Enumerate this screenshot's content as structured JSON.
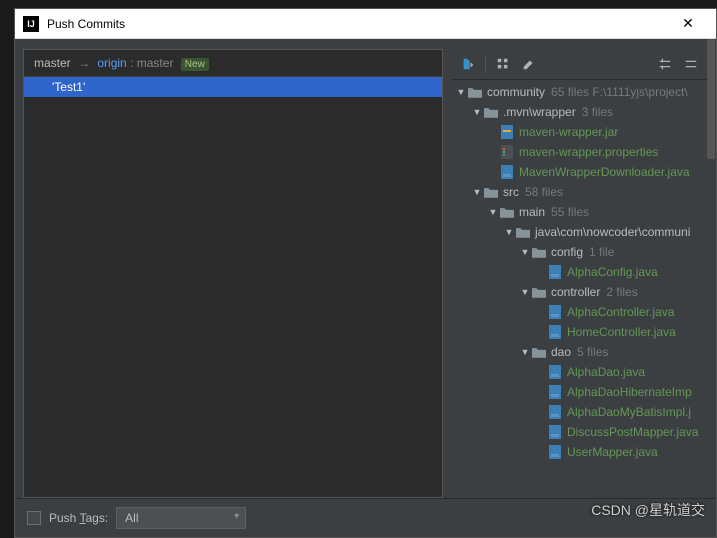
{
  "window": {
    "title": "Push Commits"
  },
  "branch": {
    "local": "master",
    "arrow": "→",
    "remote": "origin",
    "sep": ":",
    "tracking": "master",
    "new_badge": "New"
  },
  "commits": [
    {
      "label": "'Test1'"
    }
  ],
  "tree": [
    {
      "depth": 0,
      "expand": "▼",
      "kind": "folder",
      "name": "community",
      "meta": "65 files  F:\\1111yjs\\project\\"
    },
    {
      "depth": 1,
      "expand": "▼",
      "kind": "folder",
      "name": ".mvn\\wrapper",
      "meta": "3 files"
    },
    {
      "depth": 2,
      "expand": "",
      "kind": "jar",
      "name": "maven-wrapper.jar",
      "added": true
    },
    {
      "depth": 2,
      "expand": "",
      "kind": "props",
      "name": "maven-wrapper.properties",
      "added": true
    },
    {
      "depth": 2,
      "expand": "",
      "kind": "java",
      "name": "MavenWrapperDownloader.java",
      "added": true
    },
    {
      "depth": 1,
      "expand": "▼",
      "kind": "folder",
      "name": "src",
      "meta": "58 files"
    },
    {
      "depth": 2,
      "expand": "▼",
      "kind": "folder",
      "name": "main",
      "meta": "55 files"
    },
    {
      "depth": 3,
      "expand": "▼",
      "kind": "folder",
      "name": "java\\com\\nowcoder\\communi"
    },
    {
      "depth": 4,
      "expand": "▼",
      "kind": "folder",
      "name": "config",
      "meta": "1 file"
    },
    {
      "depth": 5,
      "expand": "",
      "kind": "java",
      "name": "AlphaConfig.java",
      "added": true
    },
    {
      "depth": 4,
      "expand": "▼",
      "kind": "folder",
      "name": "controller",
      "meta": "2 files"
    },
    {
      "depth": 5,
      "expand": "",
      "kind": "java",
      "name": "AlphaController.java",
      "added": true
    },
    {
      "depth": 5,
      "expand": "",
      "kind": "java",
      "name": "HomeController.java",
      "added": true
    },
    {
      "depth": 4,
      "expand": "▼",
      "kind": "folder",
      "name": "dao",
      "meta": "5 files"
    },
    {
      "depth": 5,
      "expand": "",
      "kind": "java",
      "name": "AlphaDao.java",
      "added": true
    },
    {
      "depth": 5,
      "expand": "",
      "kind": "java",
      "name": "AlphaDaoHibernateImp",
      "added": true
    },
    {
      "depth": 5,
      "expand": "",
      "kind": "java",
      "name": "AlphaDaoMyBatisImpl.j",
      "added": true
    },
    {
      "depth": 5,
      "expand": "",
      "kind": "java",
      "name": "DiscussPostMapper.java",
      "added": true
    },
    {
      "depth": 5,
      "expand": "",
      "kind": "java",
      "name": "UserMapper.java",
      "added": true
    }
  ],
  "footer": {
    "push_tags_label": "Push Tags:",
    "select_value": "All"
  },
  "watermark": "CSDN @星轨道交"
}
